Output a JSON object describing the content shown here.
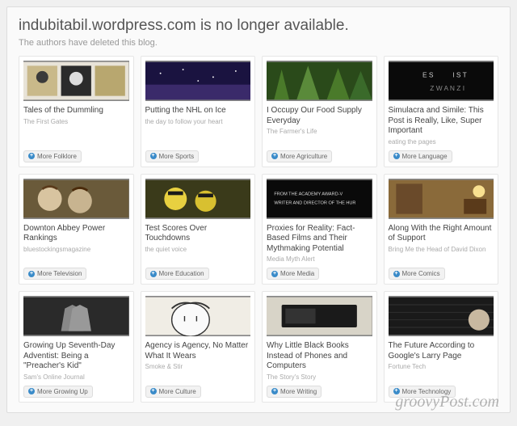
{
  "header": {
    "title": "indubitabil.wordpress.com is no longer available.",
    "subtitle": "The authors have deleted this blog."
  },
  "cards": [
    {
      "title": "Tales of the Dummling",
      "source": "The First Gates",
      "more": "More Folklore"
    },
    {
      "title": "Putting the NHL on Ice",
      "source": "the day to follow your heart",
      "more": "More Sports"
    },
    {
      "title": "I Occupy Our Food Supply Everyday",
      "source": "The Farmer's Life",
      "more": "More Agriculture"
    },
    {
      "title": "Simulacra and Simile: This Post is Really, Like, Super Important",
      "source": "eating the pages",
      "more": "More Language"
    },
    {
      "title": "Downton Abbey Power Rankings",
      "source": "bluestockingsmagazine",
      "more": "More Television"
    },
    {
      "title": "Test Scores Over Touchdowns",
      "source": "the quiet voice",
      "more": "More Education"
    },
    {
      "title": "Proxies for Reality: Fact-Based Films and Their Mythmaking Potential",
      "source": "Media Myth Alert",
      "more": "More Media"
    },
    {
      "title": "Along With the Right Amount of Support",
      "source": "Bring Me the Head of David Dixon",
      "more": "More Comics"
    },
    {
      "title": "Growing Up Seventh-Day Adventist: Being a \"Preacher's Kid\"",
      "source": "Sam's Online Journal",
      "more": "More Growing Up"
    },
    {
      "title": "Agency is Agency, No Matter What It Wears",
      "source": "Smoke & Stir",
      "more": "More Culture"
    },
    {
      "title": "Why Little Black Books Instead of Phones and Computers",
      "source": "The Story's Story",
      "more": "More Writing"
    },
    {
      "title": "The Future According to Google's Larry Page",
      "source": "Fortune Tech",
      "more": "More Technology"
    }
  ],
  "watermark": "groovyPost.com"
}
